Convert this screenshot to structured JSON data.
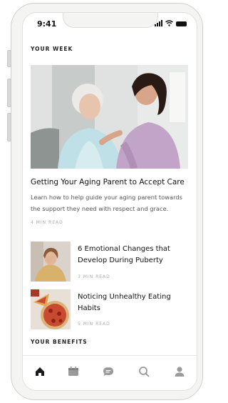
{
  "status_bar": {
    "time": "9:41"
  },
  "your_week": {
    "heading": "YOUR WEEK",
    "featured": {
      "title": "Getting Your Aging Parent to Accept Care",
      "description": "Learn how to help guide your aging parent towards the support they need with respect and grace.",
      "read_time": "4 MIN READ"
    },
    "articles": [
      {
        "title": "6 Emotional Changes that Develop During Puberty",
        "read_time": "3 MIN READ"
      },
      {
        "title": "Noticing Unhealthy Eating Habits",
        "read_time": "5 MIN READ"
      }
    ]
  },
  "your_benefits": {
    "heading": "YOUR BENEFITS"
  },
  "tab_bar": {
    "tabs": [
      {
        "icon": "home-icon",
        "active": true
      },
      {
        "icon": "calendar-icon",
        "active": false
      },
      {
        "icon": "chat-icon",
        "active": false
      },
      {
        "icon": "search-icon",
        "active": false
      },
      {
        "icon": "profile-icon",
        "active": false
      }
    ],
    "active_color": "#1a1a1a",
    "inactive_color": "#9a9a9a"
  }
}
